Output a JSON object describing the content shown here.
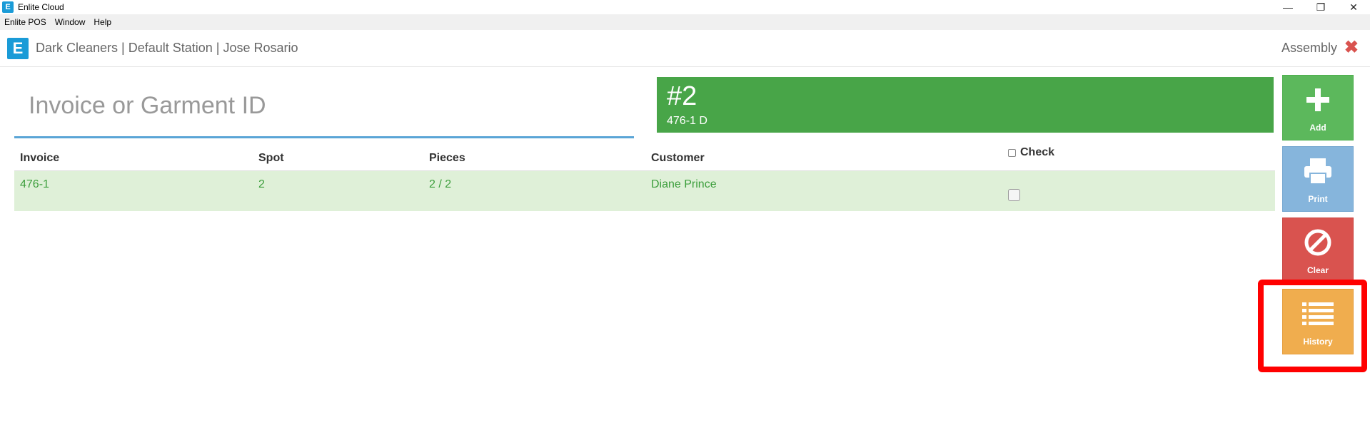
{
  "window": {
    "icon": "enlite-icon",
    "title": "Enlite Cloud",
    "controls": [
      "minimize",
      "restore",
      "close"
    ]
  },
  "menubar": {
    "items": [
      "Enlite POS",
      "Window",
      "Help"
    ]
  },
  "header": {
    "logo_letter": "E",
    "context": "Dark Cleaners | Default Station | Jose Rosario",
    "mode": "Assembly",
    "close_symbol": "✖"
  },
  "search": {
    "placeholder": "Invoice or Garment ID",
    "value": ""
  },
  "status": {
    "number": "#2",
    "subtitle": "476-1 D",
    "color": "#48a548"
  },
  "table": {
    "headers": [
      "Invoice",
      "Spot",
      "Pieces",
      "Customer",
      "Check"
    ],
    "rows": [
      {
        "invoice": "476-1",
        "spot": "2",
        "pieces": "2 / 2",
        "customer": "Diane Prince",
        "checked": false
      }
    ]
  },
  "actions": [
    {
      "label": "Add",
      "icon": "plus-icon",
      "color": "#5cb85c"
    },
    {
      "label": "Print",
      "icon": "printer-icon",
      "color": "#86b5dc"
    },
    {
      "label": "Clear",
      "icon": "no-entry-icon",
      "color": "#d9534f"
    },
    {
      "label": "History",
      "icon": "list-icon",
      "color": "#f0ad4e"
    }
  ],
  "highlight": {
    "target": "History",
    "color": "#ff0000"
  }
}
